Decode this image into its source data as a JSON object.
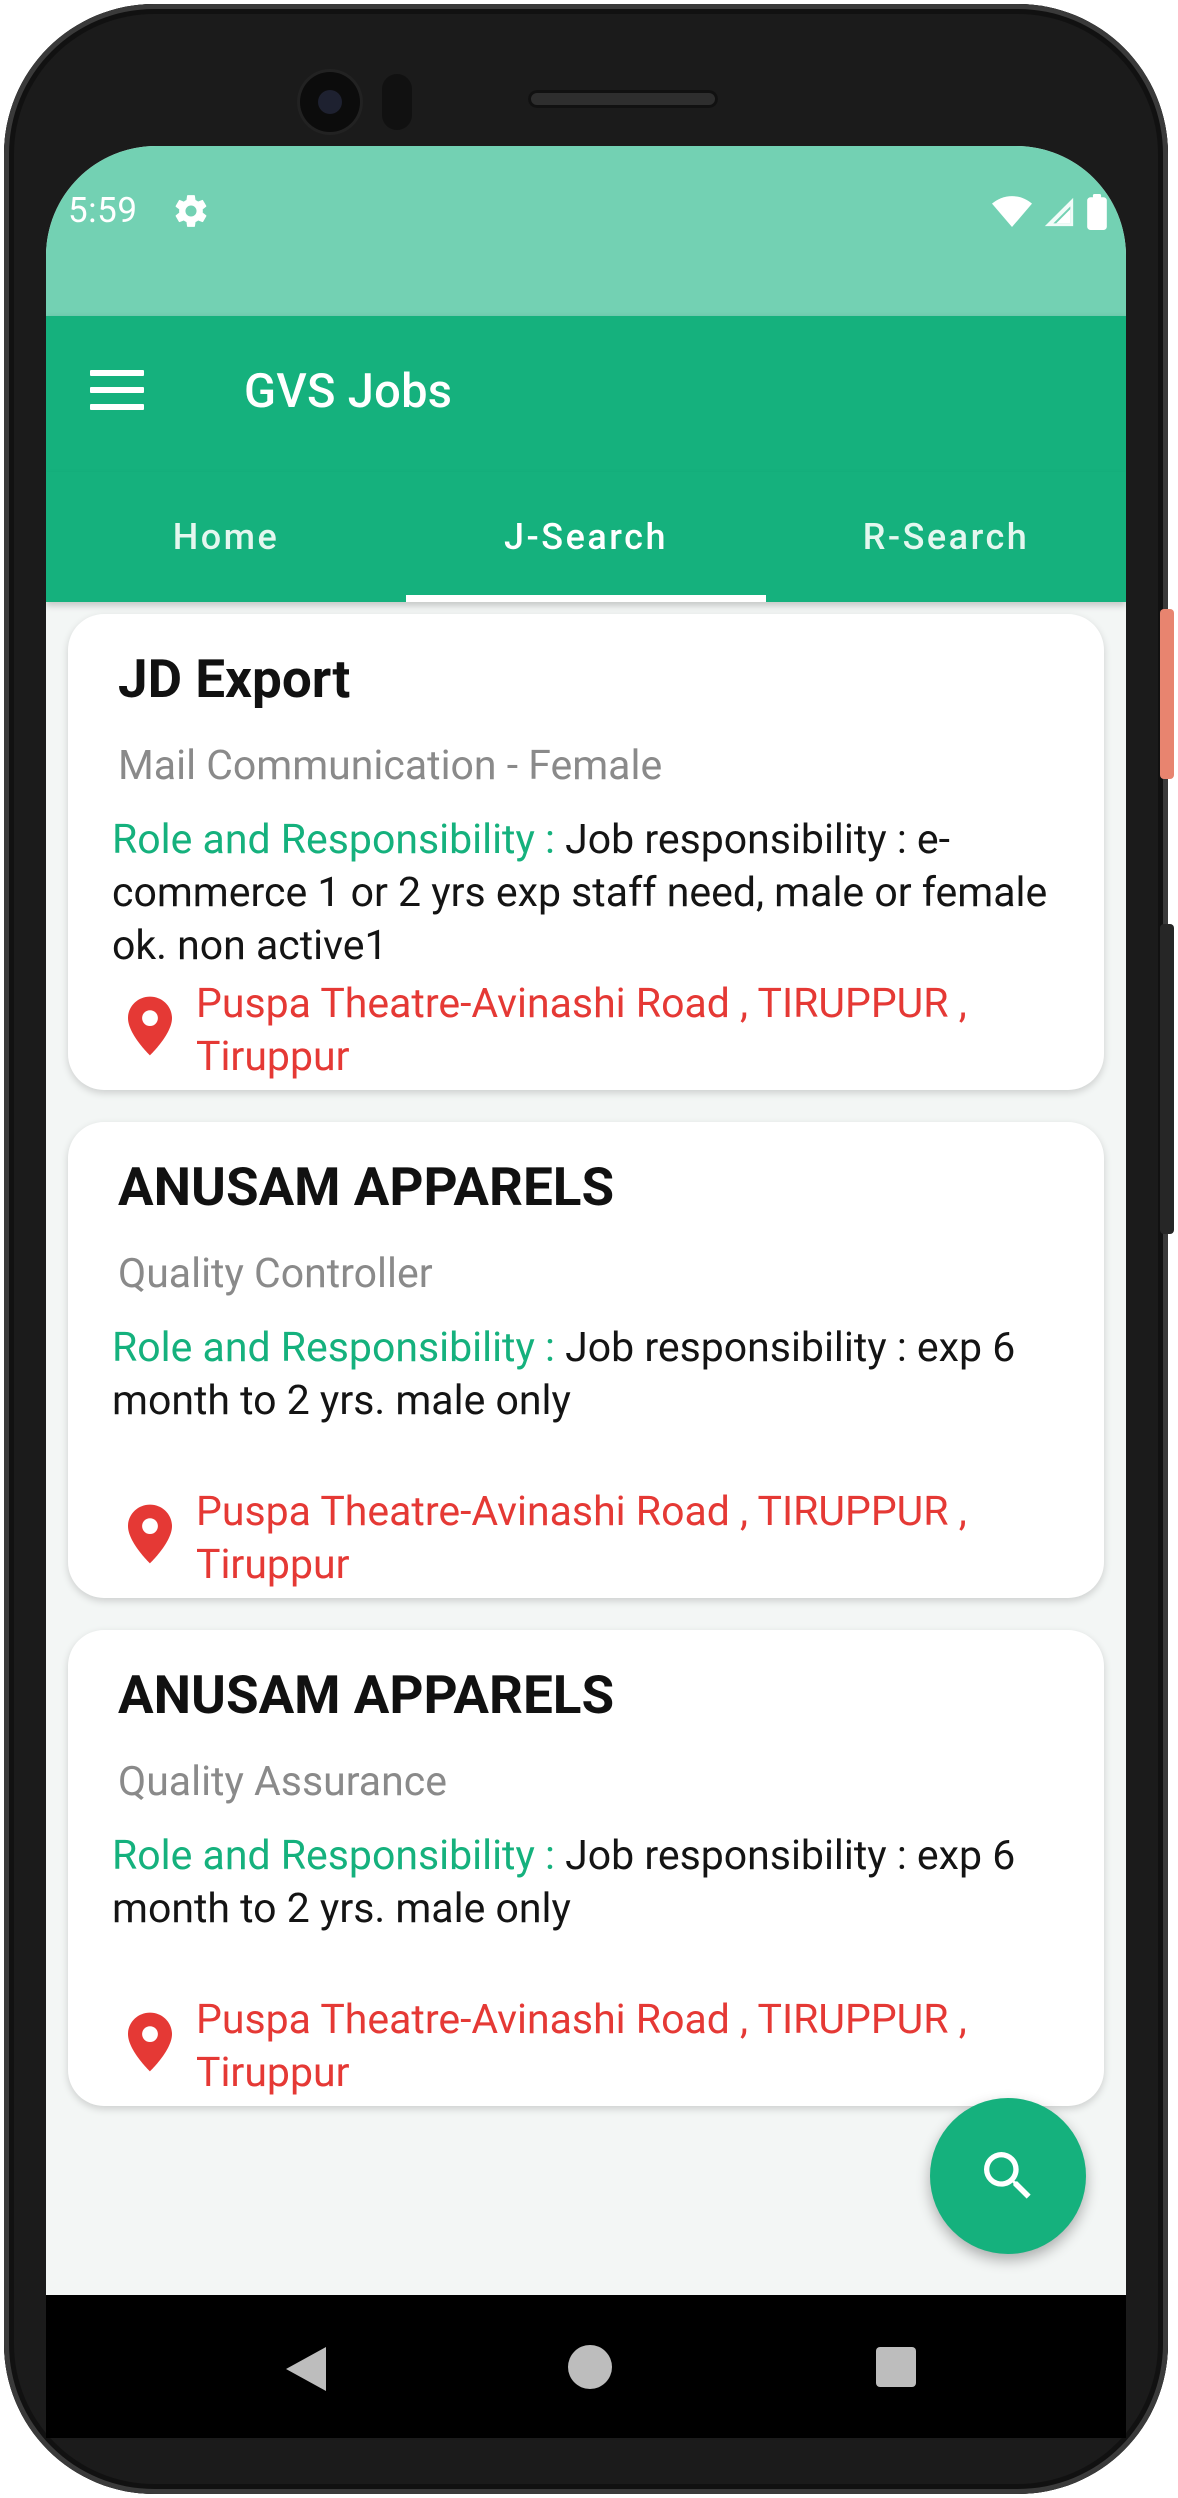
{
  "status_bar": {
    "time": "5:59"
  },
  "app_bar": {
    "title": "GVS Jobs",
    "menu_icon": "hamburger-menu-icon"
  },
  "tabs": [
    {
      "label": "Home",
      "active": false
    },
    {
      "label": "J-Search",
      "active": true
    },
    {
      "label": "R-Search",
      "active": false
    }
  ],
  "jobs": [
    {
      "company": "JD Export",
      "title": "Mail Communication - Female",
      "role_label": "Role and Responsibility : ",
      "role_text": "Job responsibility : e-commerce 1 or 2 yrs exp staff need, male or female ok. non active1",
      "location": "Puspa Theatre-Avinashi Road , TIRUPPUR , Tiruppur"
    },
    {
      "company": "ANUSAM APPARELS",
      "title": "Quality Controller",
      "role_label": "Role and Responsibility : ",
      "role_text": "Job responsibility : exp 6 month to 2 yrs. male only",
      "location": "Puspa Theatre-Avinashi Road , TIRUPPUR , Tiruppur"
    },
    {
      "company": "ANUSAM APPARELS",
      "title": "Quality Assurance",
      "role_label": "Role and Responsibility : ",
      "role_text": "Job responsibility : exp 6 month to 2 yrs. male only",
      "location": "Puspa Theatre-Avinashi Road , TIRUPPUR , Tiruppur"
    }
  ],
  "fab": {
    "icon": "search-icon"
  },
  "colors": {
    "primary": "#15b17d",
    "status_bar": "#73d1b3",
    "location_text": "#e53935",
    "secondary_text": "#8a8a8a"
  }
}
